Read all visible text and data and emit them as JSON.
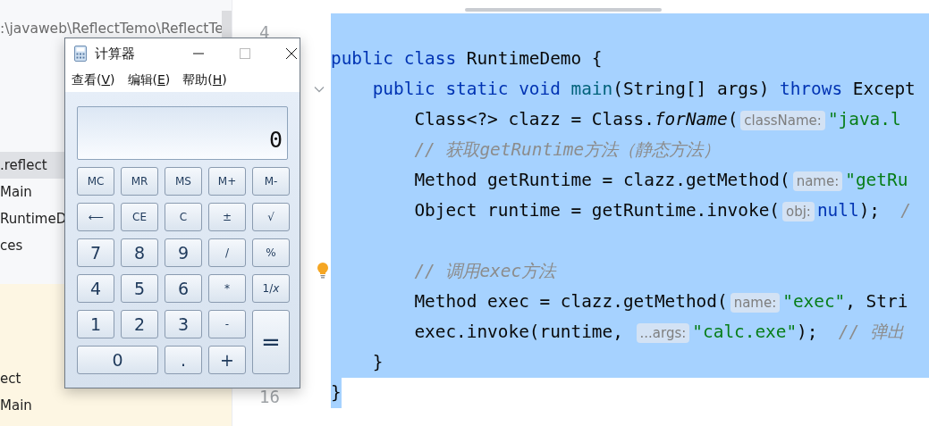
{
  "project_panel": {
    "path": ":\\javaweb\\ReflectTemo\\ReflectTe",
    "items": [
      {
        "label": ".reflect",
        "selected": true
      },
      {
        "label": "Main",
        "selected": false
      },
      {
        "label": "RuntimeD",
        "selected": false
      },
      {
        "label": "ces",
        "selected": false
      }
    ],
    "lower_items": [
      {
        "label": "ect",
        "selected": false
      },
      {
        "label": "Main",
        "selected": false
      }
    ]
  },
  "editor": {
    "lines": [
      {
        "number": "4",
        "selected": true
      },
      {
        "selected": true,
        "tokens": [
          {
            "kind": "keyword",
            "text": "public class "
          },
          {
            "kind": "plain",
            "text": "RuntimeDemo {"
          }
        ]
      },
      {
        "selected": true,
        "fold": true,
        "tokens": [
          {
            "kind": "keyword",
            "text": "    public static void "
          },
          {
            "kind": "method",
            "text": "main"
          },
          {
            "kind": "plain",
            "text": "(String[] args) "
          },
          {
            "kind": "keyword",
            "text": "throws "
          },
          {
            "kind": "plain",
            "text": "Except"
          }
        ]
      },
      {
        "selected": true,
        "tokens": [
          {
            "kind": "plain",
            "text": "        Class<?> clazz = Class."
          },
          {
            "kind": "italic",
            "text": "forName"
          },
          {
            "kind": "plain",
            "text": "("
          },
          {
            "kind": "hint",
            "text": "className:"
          },
          {
            "kind": "string",
            "text": "\"java.l"
          }
        ]
      },
      {
        "selected": true,
        "tokens": [
          {
            "kind": "comment",
            "text": "        // 获取getRuntime方法（静态方法）"
          }
        ]
      },
      {
        "selected": true,
        "tokens": [
          {
            "kind": "plain",
            "text": "        Method getRuntime = clazz.getMethod("
          },
          {
            "kind": "hint",
            "text": "name:"
          },
          {
            "kind": "string",
            "text": "\"getRu"
          }
        ]
      },
      {
        "selected": true,
        "tokens": [
          {
            "kind": "plain",
            "text": "        Object runtime = getRuntime.invoke("
          },
          {
            "kind": "hint",
            "text": "obj:"
          },
          {
            "kind": "keyword",
            "text": "null"
          },
          {
            "kind": "plain",
            "text": ");  "
          },
          {
            "kind": "comment",
            "text": "/"
          }
        ]
      },
      {
        "selected": true
      },
      {
        "selected": true,
        "bulb": true,
        "tokens": [
          {
            "kind": "comment",
            "text": "        // 调用exec方法"
          }
        ]
      },
      {
        "selected": true,
        "tokens": [
          {
            "kind": "plain",
            "text": "        Method exec = clazz.getMethod("
          },
          {
            "kind": "hint",
            "text": "name:"
          },
          {
            "kind": "string",
            "text": "\"exec\""
          },
          {
            "kind": "plain",
            "text": ", Stri"
          }
        ]
      },
      {
        "selected": true,
        "tokens": [
          {
            "kind": "plain",
            "text": "        exec.invoke(runtime, "
          },
          {
            "kind": "hint",
            "text": "...args:"
          },
          {
            "kind": "string",
            "text": "\"calc.exe\""
          },
          {
            "kind": "plain",
            "text": ");  "
          },
          {
            "kind": "comment",
            "text": "// 弹出"
          }
        ]
      },
      {
        "selected": true,
        "tokens": [
          {
            "kind": "plain",
            "text": "    }"
          }
        ]
      },
      {
        "number": "16",
        "text_selected": true,
        "tokens": [
          {
            "kind": "plain",
            "text": "}"
          }
        ]
      }
    ]
  },
  "calculator": {
    "title": "计算器",
    "menu": [
      {
        "prefix": "查看(",
        "key": "V",
        "suffix": ")"
      },
      {
        "prefix": "编辑(",
        "key": "E",
        "suffix": ")"
      },
      {
        "prefix": "帮助(",
        "key": "H",
        "suffix": ")"
      }
    ],
    "display": "0",
    "buttons": [
      {
        "label": "MC",
        "kind": "small"
      },
      {
        "label": "MR",
        "kind": "small"
      },
      {
        "label": "MS",
        "kind": "small"
      },
      {
        "label": "M+",
        "kind": "small"
      },
      {
        "label": "M-",
        "kind": "small"
      },
      {
        "label": "⟵",
        "kind": "small"
      },
      {
        "label": "CE",
        "kind": "small"
      },
      {
        "label": "C",
        "kind": "small"
      },
      {
        "label": "±",
        "kind": "small"
      },
      {
        "label": "√",
        "kind": "small"
      },
      {
        "label": "7",
        "kind": "digit"
      },
      {
        "label": "8",
        "kind": "digit"
      },
      {
        "label": "9",
        "kind": "digit"
      },
      {
        "label": "/",
        "kind": "small"
      },
      {
        "label": "%",
        "kind": "small"
      },
      {
        "label": "4",
        "kind": "digit"
      },
      {
        "label": "5",
        "kind": "digit"
      },
      {
        "label": "6",
        "kind": "digit"
      },
      {
        "label": "*",
        "kind": "small"
      },
      {
        "label": "1/*x*",
        "kind": "small"
      },
      {
        "label": "1",
        "kind": "digit"
      },
      {
        "label": "2",
        "kind": "digit"
      },
      {
        "label": "3",
        "kind": "digit"
      },
      {
        "label": "-",
        "kind": "small"
      },
      {
        "label": "=",
        "kind": "equals"
      },
      {
        "label": "0",
        "kind": "zero"
      },
      {
        "label": ".",
        "kind": "digit"
      },
      {
        "label": "+",
        "kind": "digit"
      }
    ]
  }
}
